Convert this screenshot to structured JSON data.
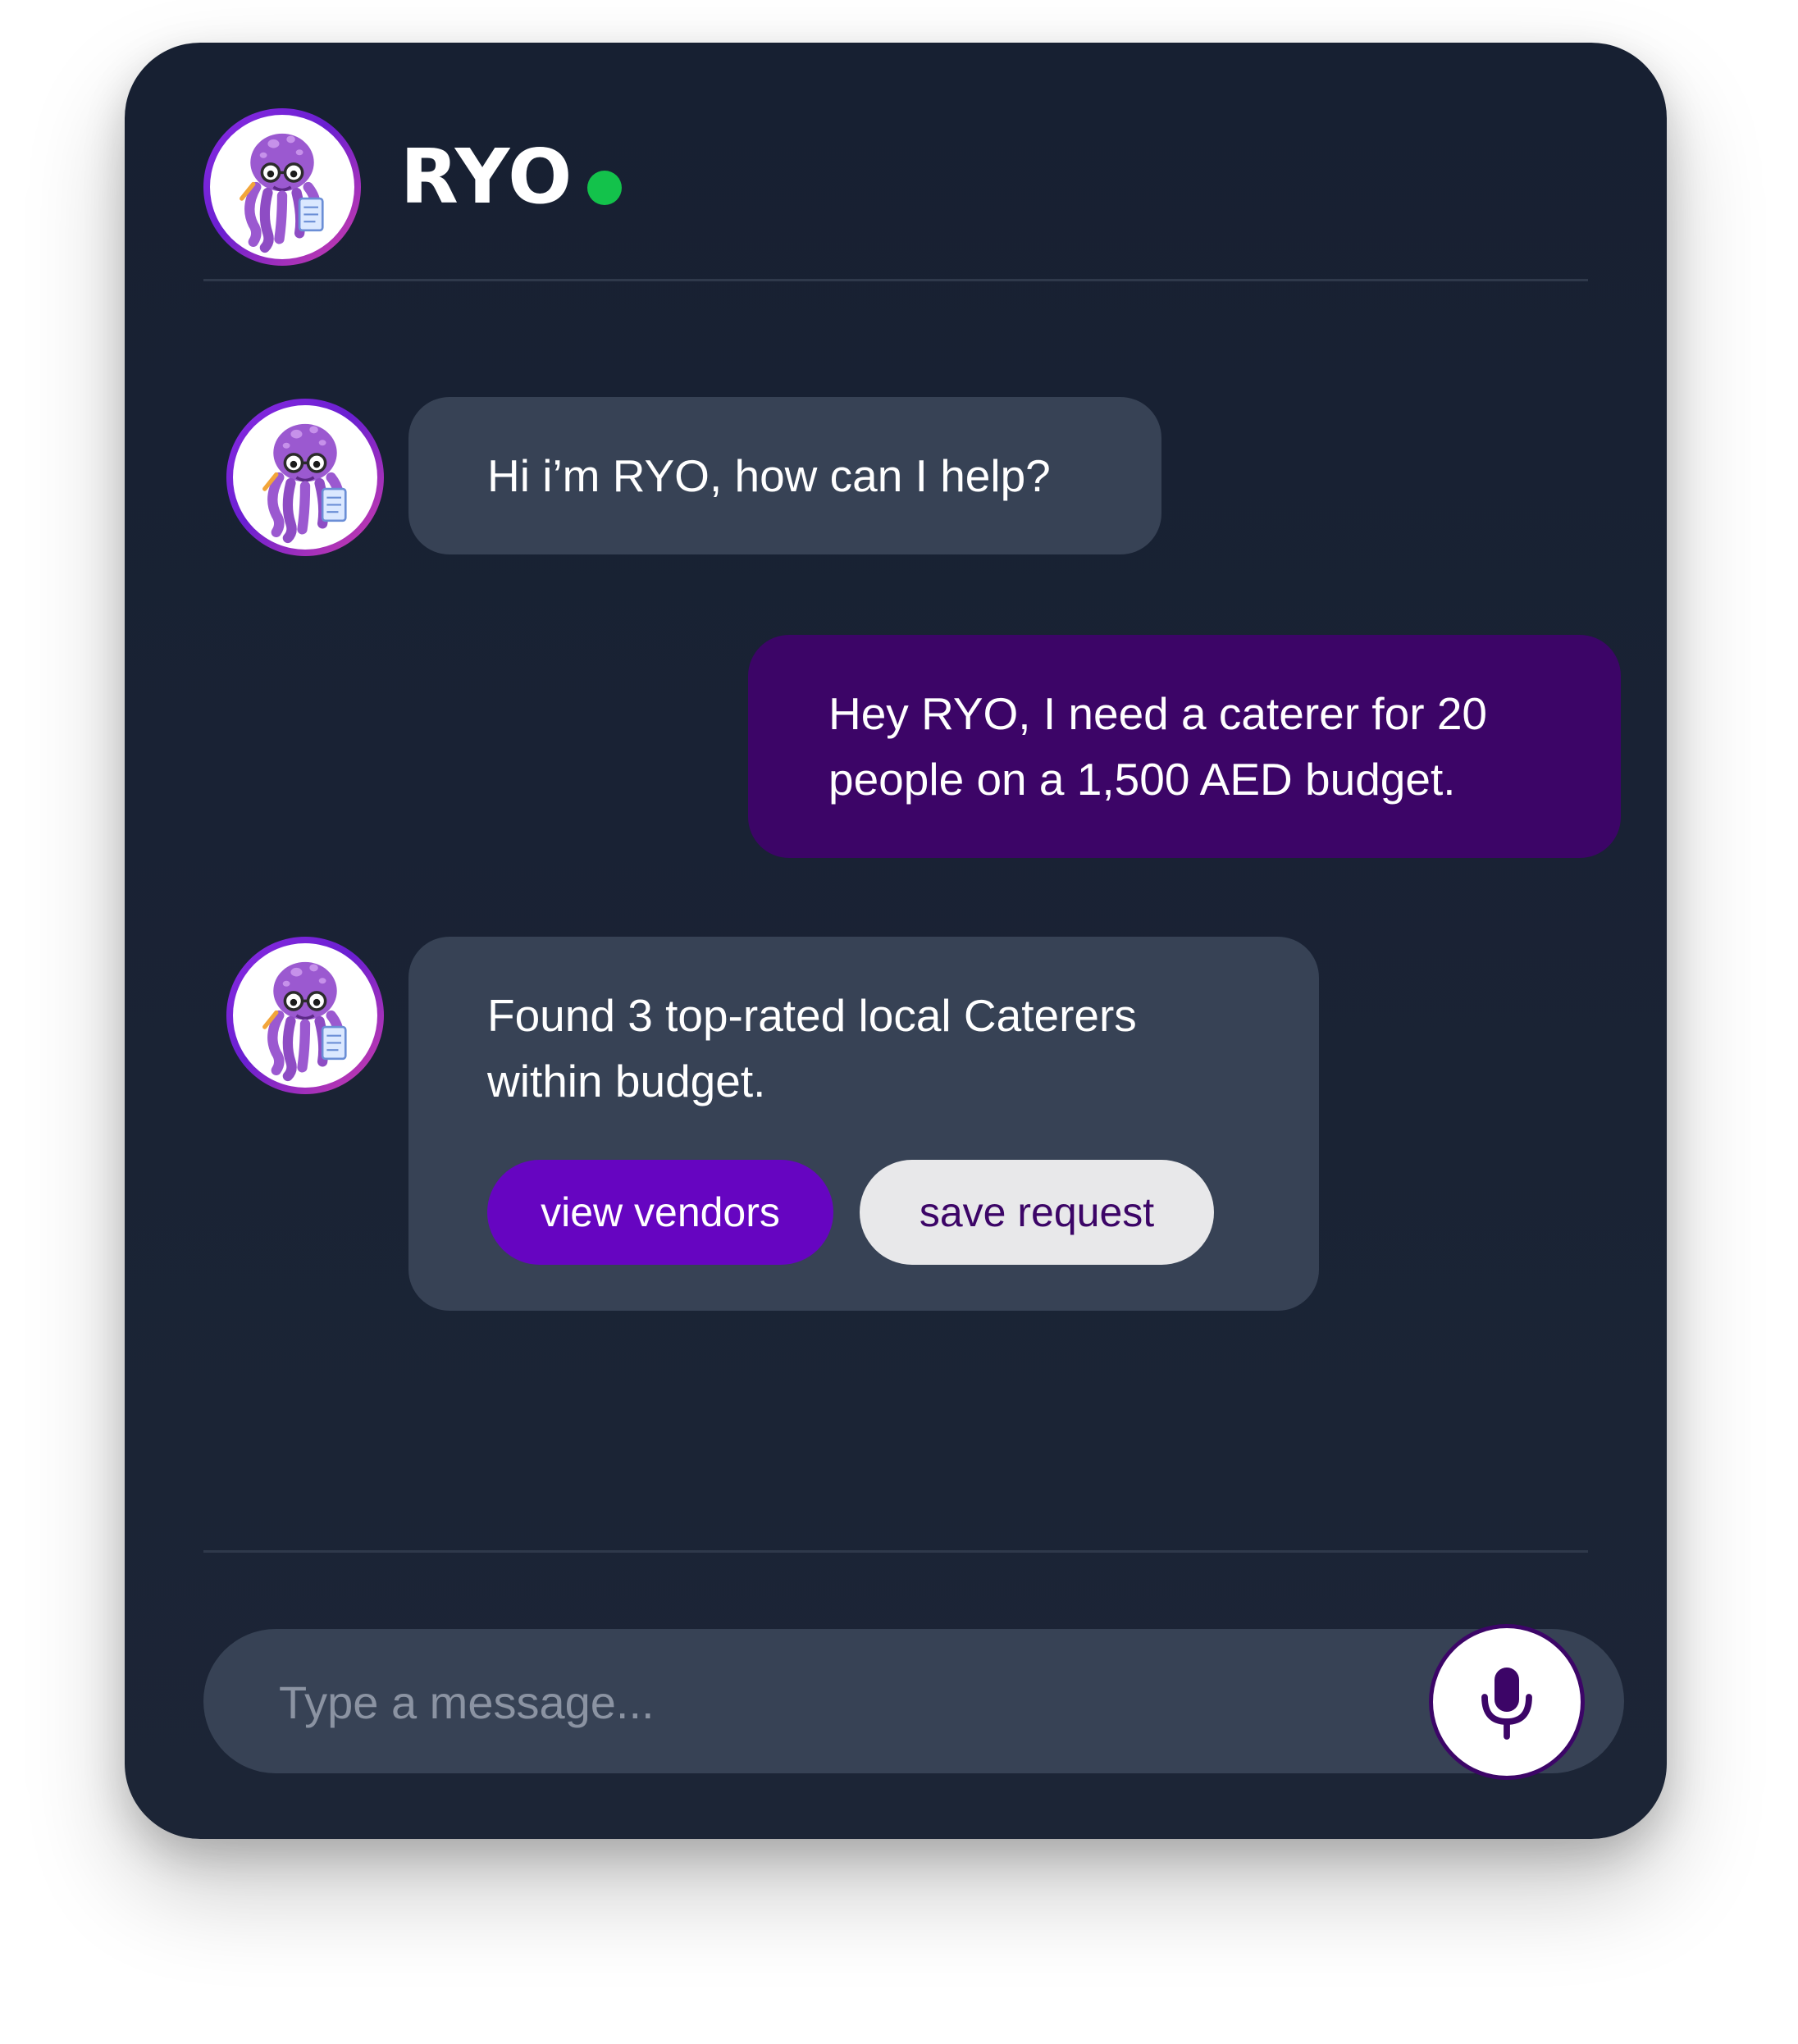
{
  "header": {
    "title": "RYO",
    "status": "online",
    "status_color": "#13c24b",
    "avatar_icon": "octopus-mascot-icon"
  },
  "messages": [
    {
      "sender": "bot",
      "text": "Hi i’m RYO, how can I help?"
    },
    {
      "sender": "user",
      "text": "Hey RYO, I need a caterer for 20 people on a 1,500 AED budget."
    },
    {
      "sender": "bot",
      "text": "Found 3 top-rated local Caterers within budget.",
      "actions": [
        {
          "label": "view vendors"
        },
        {
          "label": "save request"
        }
      ]
    }
  ],
  "composer": {
    "placeholder": "Type a message...",
    "value": "",
    "mic_icon": "microphone-icon"
  },
  "colors": {
    "panel": "#1a2233",
    "bot_bubble": "#374255",
    "user_bubble": "#3c0567",
    "primary_button": "#6605c1",
    "secondary_button": "#e8e8ea"
  }
}
